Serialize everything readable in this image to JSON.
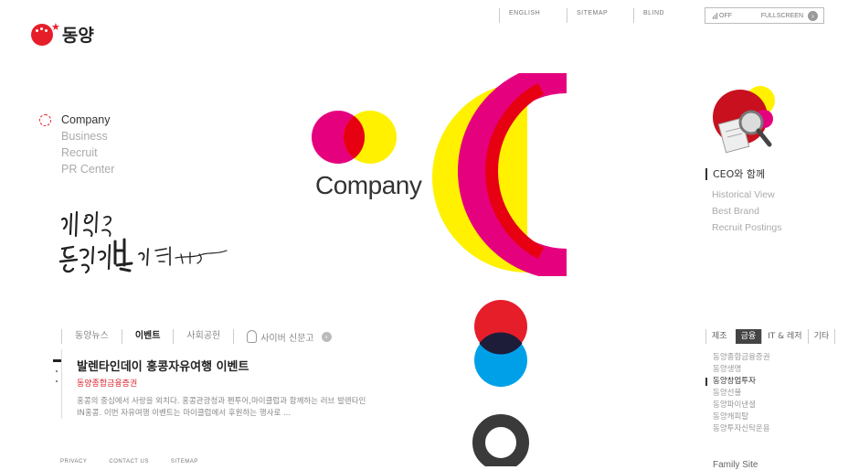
{
  "brand": {
    "name": "동양",
    "accent": "#e61e2a"
  },
  "topnav": {
    "english": "ENGLISH",
    "sitemap": "SITEMAP",
    "blind": "BLIND",
    "off": "OFF",
    "fullscreen": "FULLSCREEN"
  },
  "leftmenu": {
    "items": [
      {
        "label": "Company",
        "active": true
      },
      {
        "label": "Business",
        "active": false
      },
      {
        "label": "Recruit",
        "active": false
      },
      {
        "label": "PR Center",
        "active": false
      }
    ]
  },
  "center": {
    "label": "Company"
  },
  "right": {
    "ceo": "CEO와 함께",
    "links": [
      "Historical View",
      "Best Brand",
      "Recruit Postings"
    ]
  },
  "news": {
    "tabs": [
      "동양뉴스",
      "이벤트",
      "사회공헌"
    ],
    "active_tab": "이벤트",
    "cyber": "사이버 신문고",
    "title": "발렌타인데이 홍콩자유여행 이벤트",
    "subtitle": "동양종합금융증권",
    "body": "홍콩의 중심에서 사랑을 외치다. 홍콩관광청과 펜투어,마이클럽과 함께하는 러브 발렌타인IN홍콩. 이번 자유여행 이벤트는 마이클럽에서 후원하는 행사로 ..."
  },
  "categories": {
    "tabs": [
      "제조",
      "금융",
      "IT & 레저",
      "기타"
    ],
    "active": "금융",
    "list": [
      "동양종합금융증권",
      "동양생명",
      "동양창업투자",
      "동양선물",
      "동양파이낸셜",
      "동양캐피탈",
      "동양투자신탁운용"
    ],
    "selected": "동양창업투자"
  },
  "footer": {
    "privacy": "PRIVACY",
    "contact": "CONTACT US",
    "sitemap": "SITEMAP"
  },
  "family_site": "Family Site"
}
